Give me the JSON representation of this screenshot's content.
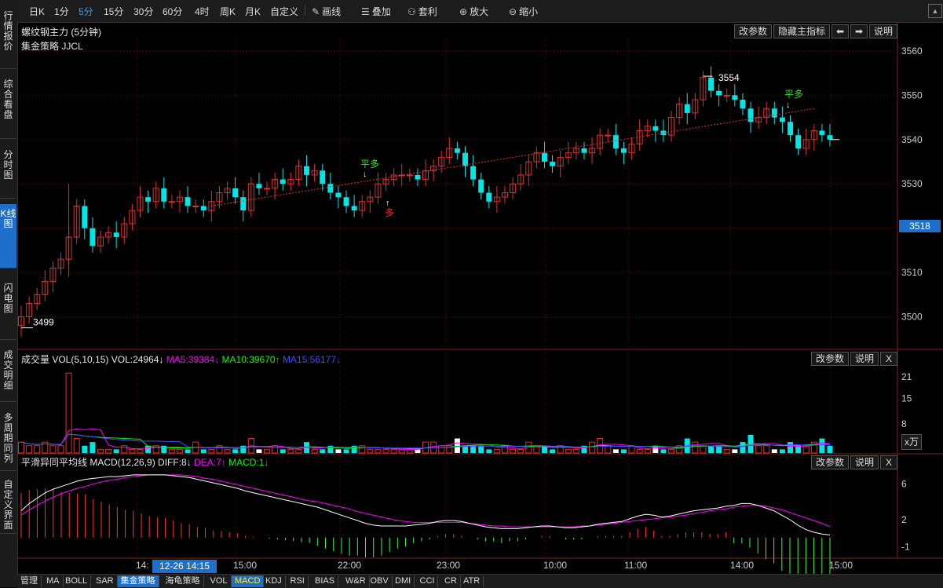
{
  "sidebar": [
    {
      "label": "行情报价",
      "active": false
    },
    {
      "label": "综合看盘",
      "active": false
    },
    {
      "label": "分时图",
      "active": false
    },
    {
      "label": "K线图",
      "active": true
    },
    {
      "label": "闪电图",
      "active": false
    },
    {
      "label": "成交明细",
      "active": false
    },
    {
      "label": "多周期同列",
      "active": false
    },
    {
      "label": "自定义界面",
      "active": false
    }
  ],
  "toolbar": {
    "periods": [
      "日K",
      "1分",
      "5分",
      "15分",
      "30分",
      "60分",
      "4时",
      "周K",
      "月K",
      "自定义"
    ],
    "active_period": "5分",
    "tools": [
      {
        "label": "画线",
        "icon": "pencil-icon"
      },
      {
        "label": "叠加",
        "icon": "layers-icon"
      },
      {
        "label": "套利",
        "icon": "arbitrage-icon"
      },
      {
        "label": "放大",
        "icon": "zoom-in-icon"
      },
      {
        "label": "缩小",
        "icon": "zoom-out-icon"
      }
    ]
  },
  "main_panel": {
    "title": "螺纹钢主力 (5分钟)",
    "indicator": "集金策略 JJCL",
    "buttons": [
      "改参数",
      "隐藏主指标",
      "⬅",
      "➡",
      "说明"
    ],
    "current_price": "3518",
    "annotations": {
      "high": "3554",
      "low": "3499",
      "signals": [
        "平多",
        "多",
        "平多"
      ]
    }
  },
  "vol_panel": {
    "title": "成交量 VOL(5,10,15)",
    "vol": "VOL:24964↓",
    "ma5": "MA5:39384↓",
    "ma10": "MA10:39670↑",
    "ma15": "MA15:56177↓",
    "buttons": [
      "改参数",
      "说明",
      "X"
    ],
    "unit": "x万"
  },
  "macd_panel": {
    "title": "平滑异同平均线 MACD(12,26,9)",
    "diff": "DIFF:8↓",
    "dea": "DEA:7↑",
    "macd": "MACD:1↓",
    "buttons": [
      "改参数",
      "说明",
      "X"
    ]
  },
  "x_axis": {
    "labels": [
      "14:",
      "15:00",
      "22:00",
      "23:00",
      "10:00",
      "11:00",
      "14:00",
      "15:00"
    ],
    "cursor_time": "12-26 14:15"
  },
  "bottom_tabs": [
    "管理",
    "MA",
    "BOLL",
    "SAR",
    "集金策略",
    "海龟策略",
    "VOL",
    "MACD",
    "KDJ",
    "RSI",
    "BIAS",
    "W&R",
    "OBV",
    "DMI",
    "CCI",
    "CR",
    "ATR"
  ],
  "active_tabs": [
    "集金策略",
    "MACD"
  ],
  "colors": {
    "up": "#e0302d",
    "down": "#00e5e5",
    "vol_up_alt": "#ffffff",
    "ma5": "#ff00ff",
    "ma10": "#00ff00",
    "ma15": "#4a4aff",
    "diff": "#ffffff",
    "dea": "#ff00ff",
    "macd_up": "#ff3333",
    "macd_down": "#33ff33",
    "grid": "#5a0f0f",
    "accent": "#1d6fc9"
  },
  "chart_data": [
    {
      "type": "candlestick",
      "y_axis_ticks": [
        3500,
        3510,
        3520,
        3530,
        3540,
        3550,
        3560
      ],
      "ylim": [
        3493,
        3563
      ],
      "close": [
        3500,
        3503,
        3505,
        3508,
        3511,
        3513,
        3518,
        3525,
        3520,
        3516,
        3518,
        3519,
        3518,
        3521,
        3524,
        3527,
        3526,
        3529,
        3526,
        3526,
        3527,
        3525,
        3525,
        3524,
        3526,
        3528,
        3529,
        3527,
        3524,
        3530,
        3529,
        3529,
        3531,
        3530,
        3531,
        3534,
        3532,
        3533,
        3530,
        3528,
        3527,
        3525,
        3524,
        3526,
        3527,
        3530,
        3531,
        3532,
        3532,
        3532,
        3531,
        3533,
        3534,
        3536,
        3538,
        3537,
        3534,
        3531,
        3528,
        3526,
        3527,
        3528,
        3530,
        3532,
        3535,
        3537,
        3535,
        3534,
        3536,
        3537,
        3538,
        3537,
        3538,
        3541,
        3541,
        3538,
        3537,
        3539,
        3542,
        3543,
        3542,
        3541,
        3545,
        3548,
        3546,
        3549,
        3554,
        3551,
        3550,
        3550,
        3549,
        3547,
        3544,
        3545,
        3547,
        3545,
        3544,
        3541,
        3538,
        3540,
        3542,
        3541,
        3540
      ],
      "annotations": [
        "3554",
        "3499",
        "平多",
        "多",
        "平多"
      ]
    },
    {
      "type": "bar",
      "name": "VOL",
      "y_axis_ticks": [
        8,
        15,
        21
      ],
      "unit": "x万",
      "values": [
        3,
        2,
        2,
        3,
        2,
        2,
        22,
        4,
        2,
        3,
        1,
        1,
        1,
        2,
        1,
        1,
        2,
        2,
        2,
        1,
        1,
        1,
        3,
        1,
        1,
        2,
        1,
        1,
        2,
        4,
        1,
        1,
        2,
        1,
        1,
        1,
        3,
        1,
        1,
        2,
        1,
        1,
        2,
        2,
        1,
        1,
        1,
        1,
        1,
        1,
        1,
        3,
        3,
        2,
        2,
        4,
        2,
        2,
        2,
        1,
        1,
        2,
        1,
        1,
        3,
        2,
        2,
        1,
        2,
        1,
        1,
        2,
        3,
        4,
        2,
        1,
        1,
        2,
        1,
        1,
        2,
        1,
        1,
        2,
        4,
        3,
        2,
        2,
        2,
        1,
        1,
        3,
        5,
        2,
        2,
        1,
        1,
        3,
        2,
        2,
        3,
        4,
        2
      ]
    },
    {
      "type": "line",
      "name": "MACD",
      "y_axis_ticks": [
        -1,
        2,
        6
      ],
      "series": [
        {
          "name": "DIFF"
        },
        {
          "name": "DEA"
        },
        {
          "name": "MACD"
        }
      ],
      "diff": [
        3,
        3.8,
        4.4,
        5,
        5.4,
        5.7,
        6,
        6.3,
        6.5,
        6.6,
        6.7,
        6.8,
        6.8,
        6.9,
        7,
        7,
        7,
        7,
        7,
        6.9,
        6.8,
        6.7,
        6.5,
        6.3,
        6.1,
        5.9,
        5.7,
        5.5,
        5.2,
        5,
        4.8,
        4.6,
        4.4,
        4.2,
        4,
        3.8,
        3.6,
        3.4,
        3.1,
        2.8,
        2.5,
        2.2,
        1.9,
        1.6,
        1.4,
        1.3,
        1.3,
        1.3,
        1.3,
        1.4,
        1.5,
        1.6,
        1.8,
        1.9,
        1.9,
        1.8,
        1.6,
        1.4,
        1.2,
        1.1,
        1,
        1,
        1,
        1.1,
        1.2,
        1.3,
        1.3,
        1.2,
        1.1,
        1.1,
        1.2,
        1.3,
        1.5,
        1.6,
        1.7,
        1.8,
        2.1,
        2.4,
        2.6,
        2.5,
        2.3,
        2.4,
        2.6,
        2.8,
        3,
        3.1,
        3.2,
        3.3,
        3.5,
        3.6,
        3.8,
        3.8,
        3.6,
        3.3,
        3,
        2.5,
        2,
        1.4,
        0.9,
        0.6,
        0.4,
        0.3
      ],
      "dea": [
        2.5,
        3.1,
        3.6,
        4.1,
        4.5,
        4.9,
        5.2,
        5.5,
        5.7,
        6,
        6.2,
        6.4,
        6.5,
        6.7,
        6.8,
        6.9,
        7,
        7,
        7,
        7,
        7,
        6.9,
        6.8,
        6.6,
        6.5,
        6.3,
        6.1,
        5.9,
        5.7,
        5.5,
        5.3,
        5.1,
        4.9,
        4.7,
        4.5,
        4.3,
        4.1,
        4,
        3.8,
        3.6,
        3.4,
        3.2,
        2.9,
        2.7,
        2.5,
        2.3,
        2.1,
        1.9,
        1.8,
        1.7,
        1.7,
        1.7,
        1.7,
        1.7,
        1.7,
        1.7,
        1.6,
        1.5,
        1.4,
        1.3,
        1.3,
        1.2,
        1.2,
        1.2,
        1.2,
        1.2,
        1.2,
        1.2,
        1.2,
        1.2,
        1.3,
        1.3,
        1.4,
        1.5,
        1.6,
        1.7,
        1.8,
        1.9,
        2,
        2.1,
        2.2,
        2.3,
        2.4,
        2.5,
        2.7,
        2.8,
        3,
        3.1,
        3.2,
        3.4,
        3.5,
        3.6,
        3.6,
        3.5,
        3.3,
        3.1,
        2.8,
        2.5,
        2.2,
        1.9,
        1.6,
        1.2
      ]
    }
  ]
}
